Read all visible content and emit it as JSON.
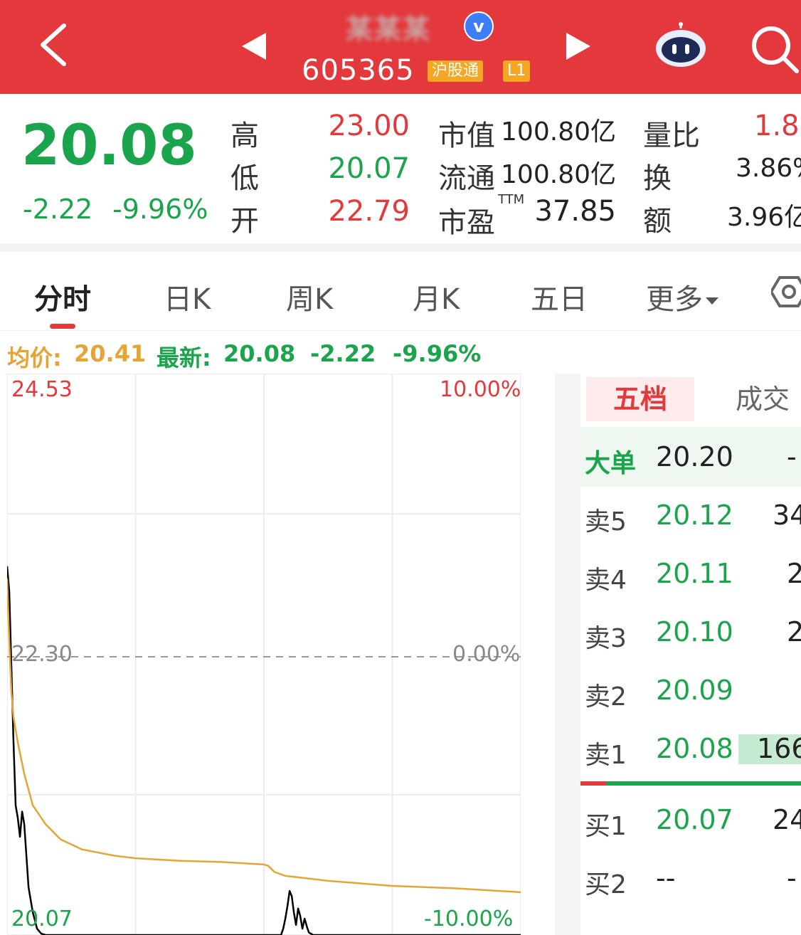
{
  "header": {
    "stock_name": "某某某",
    "verified_mark": "v",
    "code": "605365",
    "tag_connect": "沪股通",
    "tag_level": "L1",
    "icons": [
      "back-chevron-icon",
      "prev-triangle-icon",
      "next-triangle-icon",
      "robot-assistant-icon",
      "search-icon"
    ]
  },
  "quote": {
    "price": "20.08",
    "change": "-2.22",
    "change_pct": "-9.96%",
    "high_label": "高",
    "high": "23.00",
    "low_label": "低",
    "low": "20.07",
    "open_label": "开",
    "open": "22.79",
    "mktcap_label": "市值",
    "mktcap": "100.80亿",
    "float_label": "流通",
    "float": "100.80亿",
    "pe_label": "市盈",
    "pe_sup": "TTM",
    "pe": "37.85",
    "vol_ratio_label": "量比",
    "vol_ratio": "1.8",
    "turnover_label": "换",
    "turnover": "3.86%",
    "amount_label": "额",
    "amount": "3.96亿"
  },
  "tabs": [
    {
      "label": "分时",
      "active": true
    },
    {
      "label": "日K"
    },
    {
      "label": "周K"
    },
    {
      "label": "月K"
    },
    {
      "label": "五日"
    },
    {
      "label": "更多"
    }
  ],
  "indicator": {
    "avg_label": "均价:",
    "avg": "20.41",
    "latest_label": "最新:",
    "latest": "20.08",
    "change": "-2.22",
    "change_pct": "-9.96%"
  },
  "chart": {
    "y_top": "24.53",
    "y_mid": "22.30",
    "y_bottom": "20.07",
    "pct_top": "10.00%",
    "pct_mid": "0.00%",
    "pct_bottom": "-10.00%"
  },
  "chart_data": {
    "type": "line",
    "ylim": [
      20.07,
      24.53
    ],
    "reference": 22.3,
    "xlim": [
      0,
      240
    ],
    "series": [
      {
        "key": "price",
        "color": "#000000",
        "points": [
          [
            0,
            23.0
          ],
          [
            1,
            22.8
          ],
          [
            2,
            22.2
          ],
          [
            3,
            21.6
          ],
          [
            4,
            21.1
          ],
          [
            5,
            21.0
          ],
          [
            6,
            20.85
          ],
          [
            7,
            21.05
          ],
          [
            8,
            20.95
          ],
          [
            9,
            20.7
          ],
          [
            10,
            20.45
          ],
          [
            12,
            20.25
          ],
          [
            14,
            20.12
          ],
          [
            16,
            20.08
          ],
          [
            18,
            20.07
          ],
          [
            30,
            20.07
          ],
          [
            60,
            20.07
          ],
          [
            90,
            20.07
          ],
          [
            128,
            20.07
          ],
          [
            129,
            20.12
          ],
          [
            130,
            20.2
          ],
          [
            131,
            20.3
          ],
          [
            132,
            20.42
          ],
          [
            133,
            20.38
          ],
          [
            134,
            20.25
          ],
          [
            135,
            20.15
          ],
          [
            136,
            20.28
          ],
          [
            137,
            20.22
          ],
          [
            138,
            20.12
          ],
          [
            139,
            20.2
          ],
          [
            140,
            20.14
          ],
          [
            141,
            20.09
          ],
          [
            143,
            20.07
          ],
          [
            170,
            20.07
          ],
          [
            200,
            20.07
          ],
          [
            240,
            20.07
          ]
        ]
      },
      {
        "key": "avg",
        "color": "#e5a435",
        "points": [
          [
            0,
            22.9
          ],
          [
            1,
            22.4
          ],
          [
            2,
            22.0
          ],
          [
            3,
            21.8
          ],
          [
            5,
            21.6
          ],
          [
            8,
            21.35
          ],
          [
            12,
            21.1
          ],
          [
            18,
            20.95
          ],
          [
            25,
            20.83
          ],
          [
            35,
            20.75
          ],
          [
            50,
            20.7
          ],
          [
            60,
            20.68
          ],
          [
            80,
            20.66
          ],
          [
            100,
            20.65
          ],
          [
            120,
            20.63
          ],
          [
            122,
            20.62
          ],
          [
            125,
            20.57
          ],
          [
            130,
            20.54
          ],
          [
            150,
            20.5
          ],
          [
            180,
            20.46
          ],
          [
            210,
            20.44
          ],
          [
            240,
            20.41
          ]
        ]
      }
    ]
  },
  "orderbook": {
    "tab_active": "五档",
    "tab_other": "成交",
    "big_label": "大单",
    "big_price": "20.20",
    "big_vol": "-",
    "rows": [
      {
        "label": "卖5",
        "price": "20.12",
        "vol": "34"
      },
      {
        "label": "卖4",
        "price": "20.11",
        "vol": "2"
      },
      {
        "label": "卖3",
        "price": "20.10",
        "vol": "2"
      },
      {
        "label": "卖2",
        "price": "20.09",
        "vol": ""
      },
      {
        "label": "卖1",
        "price": "20.08",
        "vol": "166"
      },
      {
        "label": "买1",
        "price": "20.07",
        "vol": "24"
      },
      {
        "label": "买2",
        "price": "--",
        "vol": "-"
      }
    ]
  },
  "colors": {
    "header": "#e4393c",
    "up": "#e4393c",
    "down": "#1aa44b",
    "avg_line": "#e5a435"
  }
}
